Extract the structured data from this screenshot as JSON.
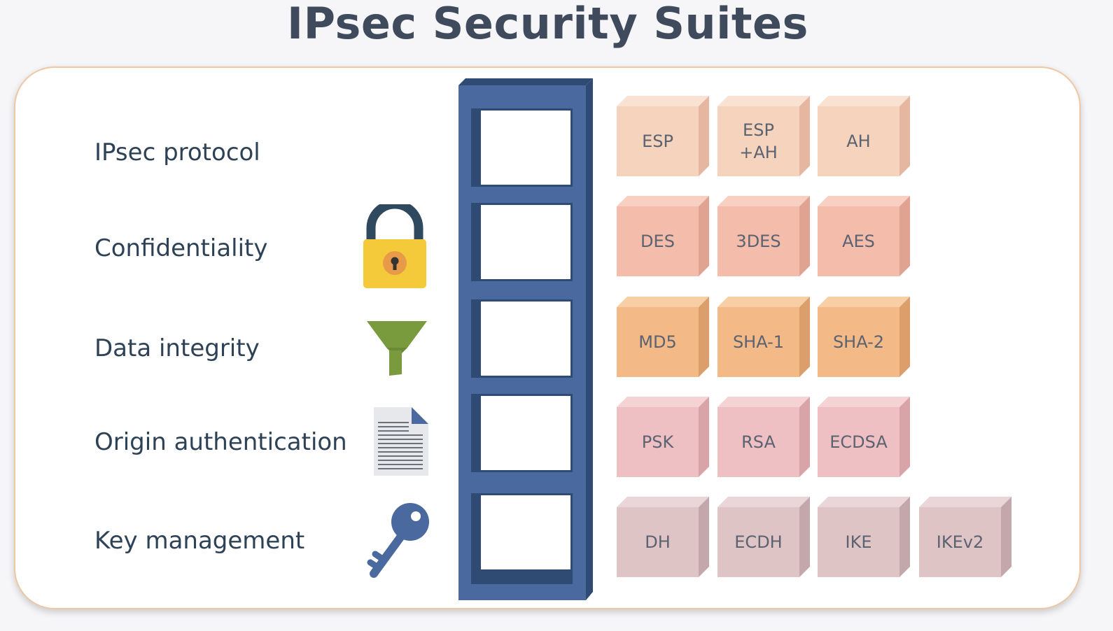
{
  "title": "IPsec Security Suites",
  "rows": [
    {
      "label": "IPsec protocol",
      "icon": "none",
      "colors": {
        "front": "#f6d3bd",
        "top": "#fae2d3",
        "side": "#e6b7a0"
      },
      "items": [
        "ESP",
        "ESP\n+AH",
        "AH"
      ]
    },
    {
      "label": "Confidentiality",
      "icon": "padlock-icon",
      "colors": {
        "front": "#f3bcab",
        "top": "#f8d0c3",
        "side": "#e0a391"
      },
      "items": [
        "DES",
        "3DES",
        "AES"
      ]
    },
    {
      "label": "Data integrity",
      "icon": "funnel-icon",
      "colors": {
        "front": "#f3b987",
        "top": "#f8cfa5",
        "side": "#dc9f6b"
      },
      "items": [
        "MD5",
        "SHA-1",
        "SHA-2"
      ]
    },
    {
      "label": "Origin authentication",
      "icon": "document-icon",
      "colors": {
        "front": "#eec0c3",
        "top": "#f5d3d5",
        "side": "#d8a4a8"
      },
      "items": [
        "PSK",
        "RSA",
        "ECDSA"
      ]
    },
    {
      "label": "Key management",
      "icon": "key-icon",
      "colors": {
        "front": "#dfc4c6",
        "top": "#ead6d8",
        "side": "#c4a7aa"
      },
      "items": [
        "DH",
        "ECDH",
        "IKE",
        "IKEv2"
      ]
    }
  ],
  "colors": {
    "shelf_front": "#4a6a9f",
    "shelf_dark": "#2f4a73",
    "title": "#3f4a5c",
    "label": "#2e4257"
  }
}
